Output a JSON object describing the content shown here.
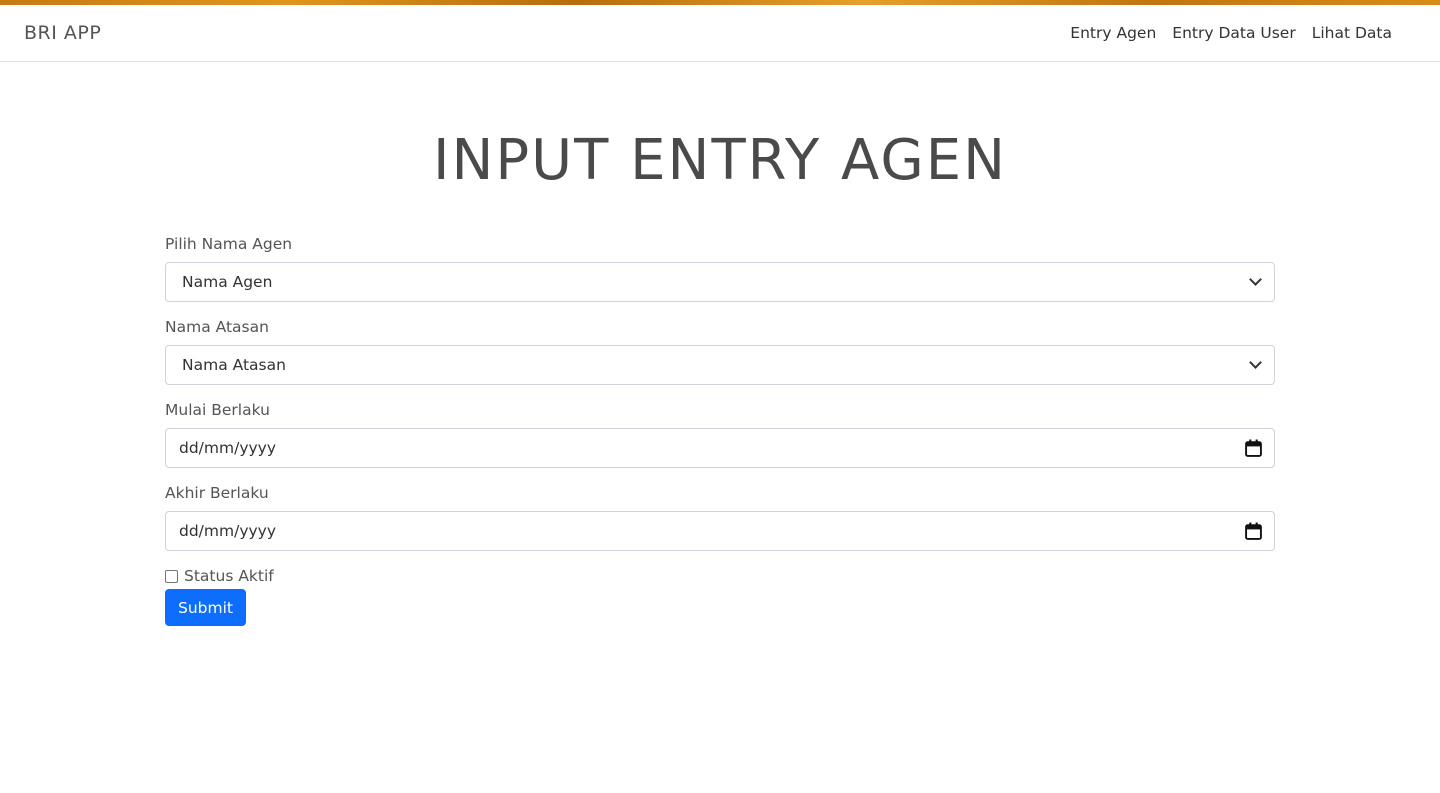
{
  "navbar": {
    "brand": "BRI APP",
    "links": [
      "Entry Agen",
      "Entry Data User",
      "Lihat Data"
    ]
  },
  "page": {
    "title": "INPUT ENTRY AGEN"
  },
  "form": {
    "agen_label": "Pilih Nama Agen",
    "agen_value": "Nama Agen",
    "atasan_label": "Nama Atasan",
    "atasan_value": "Nama Atasan",
    "mulai_label": "Mulai Berlaku",
    "mulai_value": "dd/mm/yyyy",
    "akhir_label": "Akhir Berlaku",
    "akhir_value": "dd/mm/yyyy",
    "status_label": "Status Aktif",
    "status_checked": false,
    "submit_label": "Submit"
  },
  "colors": {
    "accent": "#0d6efd",
    "stripe": "#d98c18"
  }
}
